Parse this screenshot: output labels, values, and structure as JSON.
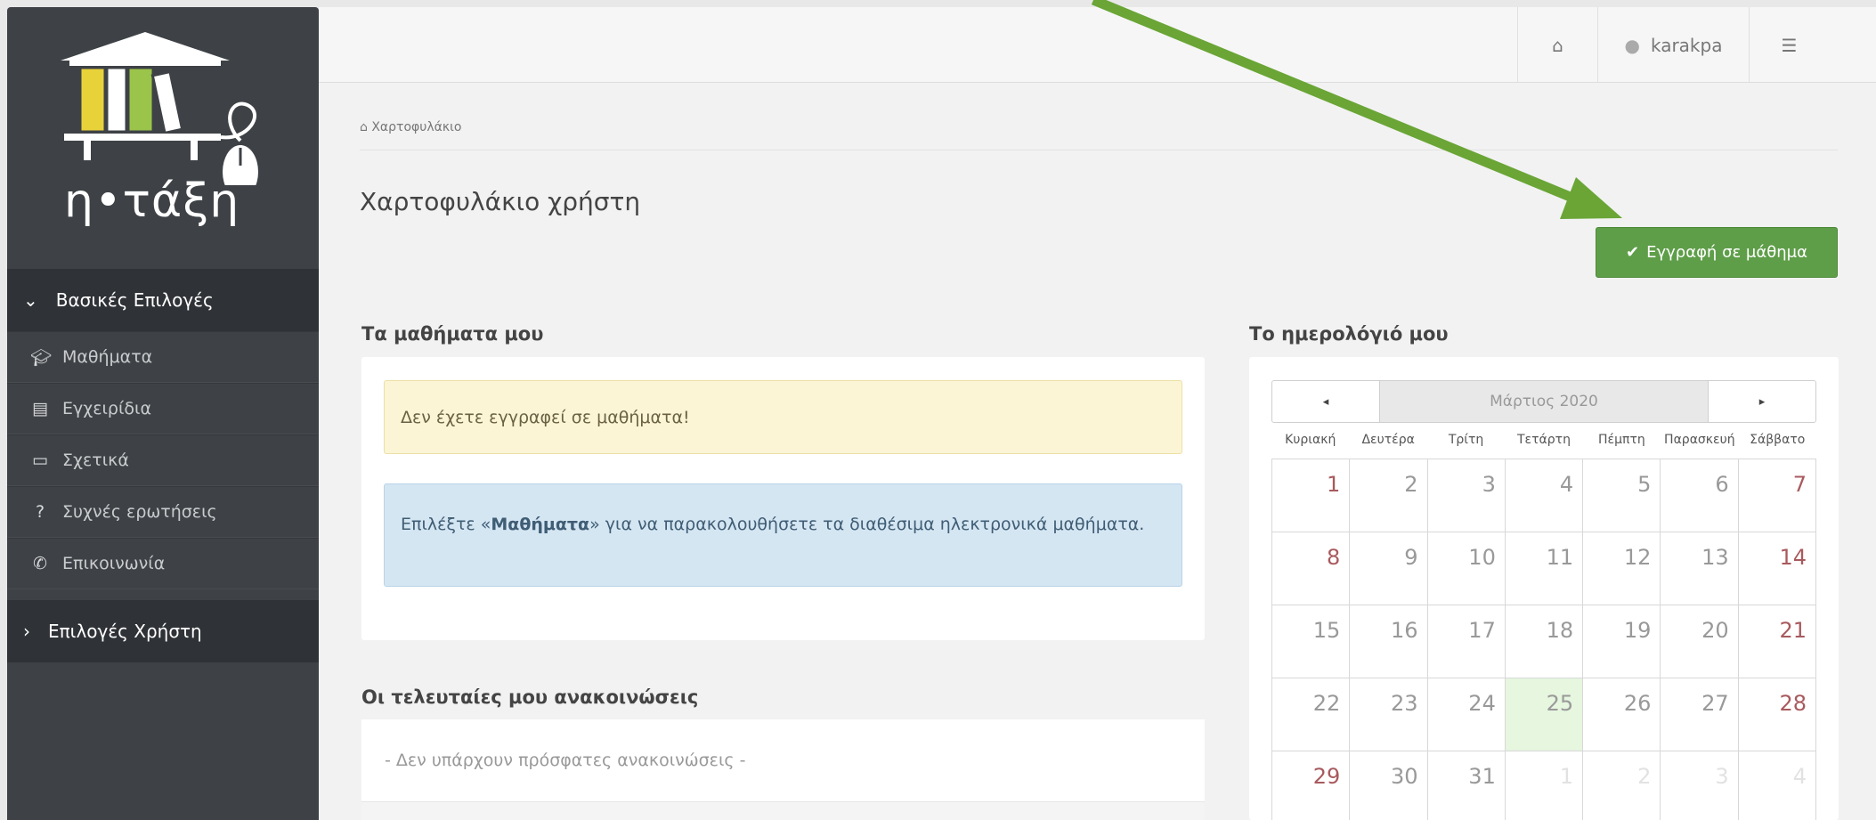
{
  "sidebar": {
    "logo_text": "η•τάξη",
    "sections": [
      {
        "label": "Βασικές Επιλογές",
        "state": "expanded"
      },
      {
        "label": "Επιλογές Χρήστη",
        "state": "collapsed"
      }
    ],
    "items": [
      {
        "label": "Μαθήματα",
        "icon": "graduation-cap-icon"
      },
      {
        "label": "Εγχειρίδια",
        "icon": "document-icon"
      },
      {
        "label": "Σχετικά",
        "icon": "credit-card-icon"
      },
      {
        "label": "Συχνές ερωτήσεις",
        "icon": "question-circle-icon"
      },
      {
        "label": "Επικοινωνία",
        "icon": "phone-icon"
      }
    ]
  },
  "topbar": {
    "home_icon": "home-icon",
    "username": "karakpa",
    "user_icon": "user-icon",
    "settings_icon": "sliders-icon"
  },
  "breadcrumb": "Χαρτοφυλάκιο",
  "page_title": "Χαρτοφυλάκιο χρήστη",
  "enroll_button": "Εγγραφή σε μάθημα",
  "courses": {
    "title": "Τα μαθήματα μου",
    "warning": "Δεν έχετε εγγραφεί σε μαθήματα!",
    "info_prefix": "Επιλέξτε «",
    "info_bold": "Μαθήματα",
    "info_suffix": "» για να παρακολουθήσετε τα διαθέσιμα ηλεκτρονικά μαθήματα."
  },
  "announcements": {
    "title": "Οι τελευταίες μου ανακοινώσεις",
    "empty": "- Δεν υπάρχουν πρόσφατες ανακοινώσεις -"
  },
  "calendar": {
    "title": "Το ημερολόγιό μου",
    "month": "Μάρτιος 2020",
    "prev": "◂",
    "next": "▸",
    "days": [
      "Κυριακή",
      "Δευτέρα",
      "Τρίτη",
      "Τετάρτη",
      "Πέμπτη",
      "Παρασκευή",
      "Σάββατο"
    ],
    "weeks": [
      [
        "1",
        "2",
        "3",
        "4",
        "5",
        "6",
        "7"
      ],
      [
        "8",
        "9",
        "10",
        "11",
        "12",
        "13",
        "14"
      ],
      [
        "15",
        "16",
        "17",
        "18",
        "19",
        "20",
        "21"
      ],
      [
        "22",
        "23",
        "24",
        "25",
        "26",
        "27",
        "28"
      ],
      [
        "29",
        "30",
        "31",
        "1",
        "2",
        "3",
        "4"
      ]
    ],
    "today": "25",
    "colors": {
      "weekend": "#a85a5e",
      "today_bg": "#e6f6df"
    }
  },
  "annotation_arrow_color": "#6aa536",
  "accent": "#5f9e49"
}
